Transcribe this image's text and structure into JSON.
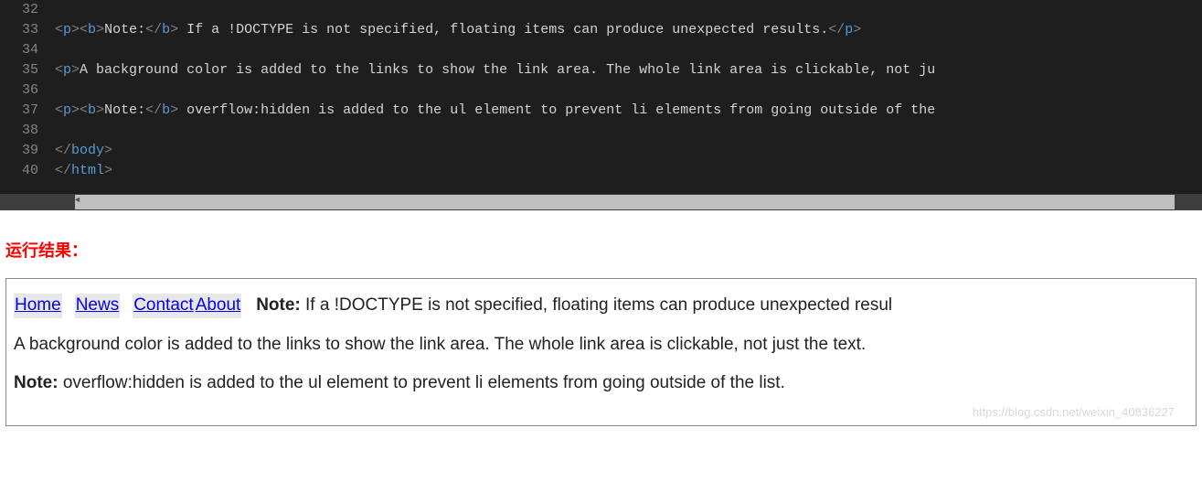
{
  "editor": {
    "lines": [
      {
        "num": "32",
        "segs": []
      },
      {
        "num": "33",
        "segs": [
          {
            "c": "tag",
            "t": "<"
          },
          {
            "c": "elname",
            "t": "p"
          },
          {
            "c": "tag",
            "t": "><"
          },
          {
            "c": "elname",
            "t": "b"
          },
          {
            "c": "tag",
            "t": ">"
          },
          {
            "c": "txt",
            "t": "Note:"
          },
          {
            "c": "tag",
            "t": "</"
          },
          {
            "c": "elname",
            "t": "b"
          },
          {
            "c": "tag",
            "t": ">"
          },
          {
            "c": "txt",
            "t": " If a !DOCTYPE is not specified, floating items can produce unexpected results."
          },
          {
            "c": "tag",
            "t": "</"
          },
          {
            "c": "elname",
            "t": "p"
          },
          {
            "c": "tag",
            "t": ">"
          }
        ]
      },
      {
        "num": "34",
        "segs": []
      },
      {
        "num": "35",
        "segs": [
          {
            "c": "tag",
            "t": "<"
          },
          {
            "c": "elname",
            "t": "p"
          },
          {
            "c": "tag",
            "t": ">"
          },
          {
            "c": "txt",
            "t": "A background color is added to the links to show the link area. The whole link area is clickable, not ju"
          }
        ]
      },
      {
        "num": "36",
        "segs": []
      },
      {
        "num": "37",
        "segs": [
          {
            "c": "tag",
            "t": "<"
          },
          {
            "c": "elname",
            "t": "p"
          },
          {
            "c": "tag",
            "t": "><"
          },
          {
            "c": "elname",
            "t": "b"
          },
          {
            "c": "tag",
            "t": ">"
          },
          {
            "c": "txt",
            "t": "Note:"
          },
          {
            "c": "tag",
            "t": "</"
          },
          {
            "c": "elname",
            "t": "b"
          },
          {
            "c": "tag",
            "t": ">"
          },
          {
            "c": "txt",
            "t": " overflow:hidden is added to the ul element to prevent li elements from going outside of the"
          }
        ]
      },
      {
        "num": "38",
        "segs": []
      },
      {
        "num": "39",
        "segs": [
          {
            "c": "tag",
            "t": "</"
          },
          {
            "c": "elname",
            "t": "body"
          },
          {
            "c": "tag",
            "t": ">"
          }
        ]
      },
      {
        "num": "40",
        "segs": [
          {
            "c": "tag",
            "t": "</"
          },
          {
            "c": "elname",
            "t": "html"
          },
          {
            "c": "tag",
            "t": ">"
          }
        ]
      }
    ]
  },
  "section_title": "运行结果：",
  "result": {
    "nav": {
      "home": "Home",
      "news": "News",
      "contact": "Contact",
      "about": "About"
    },
    "note1_label": "Note:",
    "note1_text": " If a !DOCTYPE is not specified, floating items can produce unexpected resul",
    "p2": "A background color is added to the links to show the link area. The whole link area is clickable, not just the text.",
    "note2_label": "Note:",
    "note2_text": " overflow:hidden is added to the ul element to prevent li elements from going outside of the list."
  },
  "watermark": "https://blog.csdn.net/weixin_40836227"
}
